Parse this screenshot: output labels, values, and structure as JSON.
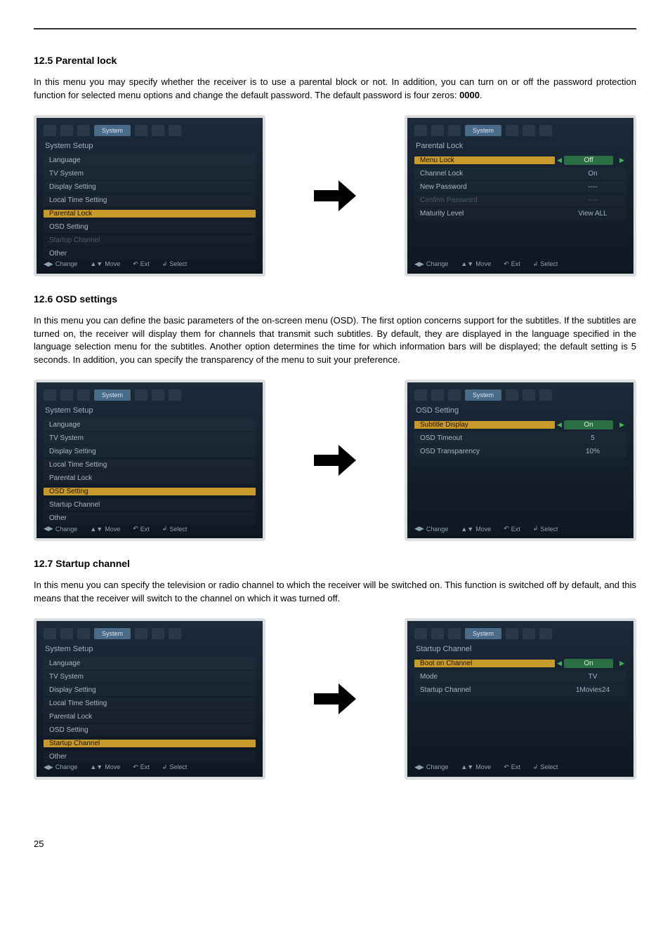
{
  "page_number": "25",
  "sections": {
    "s1": {
      "heading": "12.5 Parental lock",
      "para_a": "In this menu you may specify whether the receiver is to use a parental block or not. In addition, you can turn on or off the password protection function for selected menu options and change the default password. The default password is four zeros: ",
      "para_bold": "0000",
      "para_b": "."
    },
    "s2": {
      "heading": "12.6 OSD settings",
      "para": "In this menu you can define the basic parameters of the on-screen menu (OSD). The first option concerns support for the subtitles. If the subtitles are turned on, the receiver will display them for channels that transmit such subtitles. By default, they are displayed in the language specified in the language selection menu for the subtitles. Another option determines the time for which information bars will be displayed; the default setting is 5 seconds. In addition, you can specify the transparency of the menu to suit your preference."
    },
    "s3": {
      "heading": "12.7 Startup channel",
      "para": "In this menu you can specify the television or radio channel to which the receiver will be switched on. This function is switched off by default, and this means that the receiver will switch to the channel on which it was turned off."
    }
  },
  "osd_common": {
    "tab_active": "System",
    "footer": {
      "change": "Change",
      "move": "Move",
      "exit": "Ext",
      "select": "Select"
    }
  },
  "osd_left_setup": {
    "title": "System Setup",
    "items": [
      "Language",
      "TV System",
      "Display Setting",
      "Local Time Setting",
      "Parental Lock",
      "OSD Setting",
      "Startup Channel",
      "Other"
    ]
  },
  "osd_parental": {
    "title": "Parental Lock",
    "rows": [
      {
        "label": "Menu Lock",
        "value": "Off",
        "sel": true
      },
      {
        "label": "Channel Lock",
        "value": "On"
      },
      {
        "label": "New Password",
        "value": "----"
      },
      {
        "label": "Confirm Password",
        "value": "----",
        "dim": true
      },
      {
        "label": "Maturity Level",
        "value": "View ALL"
      }
    ]
  },
  "osd_osd": {
    "title": "OSD Setting",
    "rows": [
      {
        "label": "Subtitle Display",
        "value": "On",
        "sel": true
      },
      {
        "label": "OSD Timeout",
        "value": "5"
      },
      {
        "label": "OSD Transparency",
        "value": "10%"
      }
    ]
  },
  "osd_startup": {
    "title": "Startup Channel",
    "rows": [
      {
        "label": "Boot on Channel",
        "value": "On",
        "sel": true
      },
      {
        "label": "Mode",
        "value": "TV"
      },
      {
        "label": "Startup Channel",
        "value": "1Movies24"
      }
    ]
  }
}
